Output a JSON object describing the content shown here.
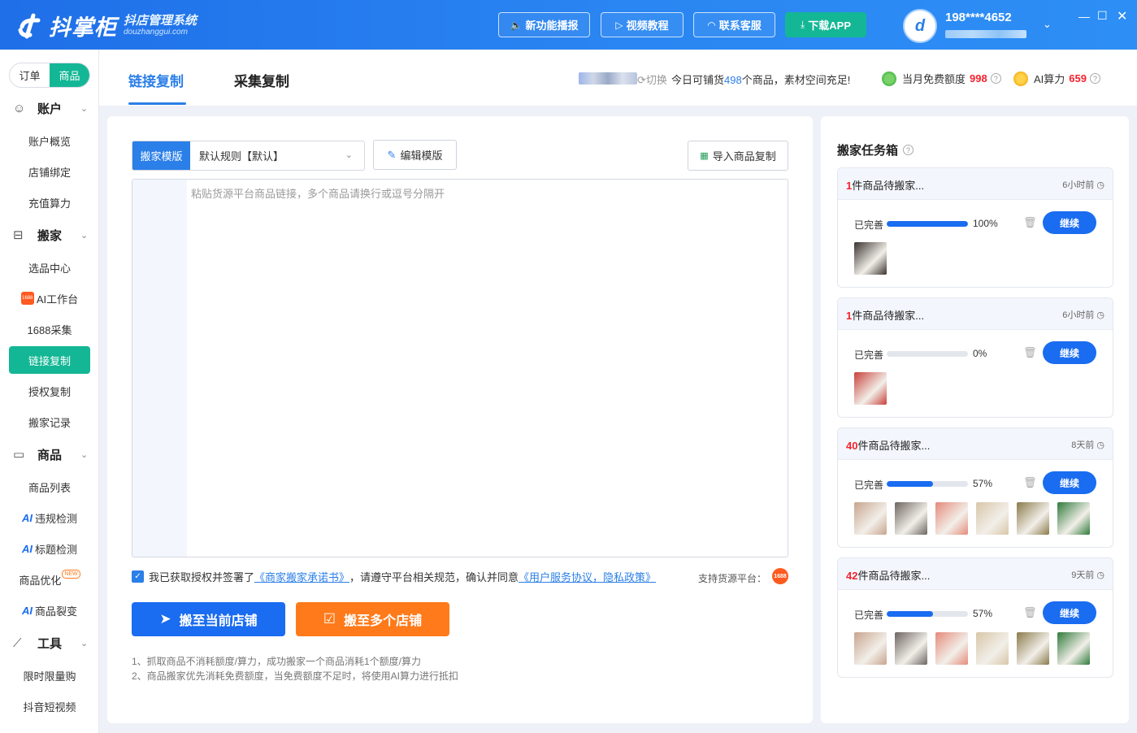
{
  "app": {
    "logo_text": "抖掌柜",
    "logo_sub": "抖店管理系统",
    "logo_domain": "douzhanggui.com"
  },
  "titlebar": {
    "buttons": [
      {
        "label": "新功能播报",
        "icon": "speaker-icon"
      },
      {
        "label": "视频教程",
        "icon": "video-icon"
      },
      {
        "label": "联系客服",
        "icon": "headset-icon"
      },
      {
        "label": "下载APP",
        "icon": "download-icon"
      }
    ],
    "user_phone": "198****4652",
    "window_controls": [
      "minimize",
      "maximize",
      "close"
    ]
  },
  "sidebar": {
    "segment": {
      "orders": "订单",
      "products": "商品",
      "selected": "商品"
    },
    "sections": [
      {
        "label": "账户",
        "icon": "account-icon",
        "items": [
          "账户概览",
          "店铺绑定",
          "充值算力"
        ]
      },
      {
        "label": "搬家",
        "icon": "move-icon",
        "items": [
          "选品中心",
          "AI工作台",
          "1688采集",
          "链接复制",
          "授权复制",
          "搬家记录"
        ]
      },
      {
        "label": "商品",
        "icon": "product-icon",
        "items": [
          "商品列表",
          "违规检测",
          "标题检测",
          "商品优化",
          "商品裂变"
        ]
      },
      {
        "label": "工具",
        "icon": "chart-icon",
        "items": [
          "限时限量购",
          "抖音短视频"
        ]
      }
    ],
    "active_item": "链接复制",
    "ai_prefix": "AI",
    "new_badge": "NEW",
    "badge_1688": "1688"
  },
  "tabs": [
    {
      "label": "链接复制",
      "active": true
    },
    {
      "label": "采集复制",
      "active": false
    }
  ],
  "topinfo": {
    "switch": "切换",
    "msg_pre": "今日可铺货",
    "msg_num": "498",
    "msg_post": "个商品，素材空间充足!",
    "free_quota_label": "当月免费额度",
    "free_quota_value": "998",
    "ai_power_label": "AI算力",
    "ai_power_value": "659"
  },
  "form": {
    "template_label": "搬家模版",
    "template_value": "默认规则【默认】",
    "edit_template": "编辑模版",
    "import_copy": "导入商品复制",
    "placeholder": "粘贴货源平台商品链接，多个商品请换行或逗号分隔开",
    "agree_pre": "我已获取授权并签署了",
    "agree_link1": "《商家搬家承诺书》",
    "agree_mid": "，请遵守平台相关规范，确认并同意",
    "agree_link2": "《用户服务协议，隐私政策》",
    "support_label": "支持货源平台：",
    "btn_current": "搬至当前店铺",
    "btn_multi": "搬至多个店铺",
    "notes": [
      "1、抓取商品不消耗额度/算力，成功搬家一个商品消耗1个额度/算力",
      "2、商品搬家优先消耗免费额度，当免费额度不足时，将使用AI算力进行抵扣"
    ]
  },
  "taskbox": {
    "title": "搬家任务箱",
    "done_label": "已完善",
    "continue_label": "继续",
    "tasks": [
      {
        "count": "1",
        "suffix": "件商品待搬家...",
        "time": "6小时前",
        "progress_text": "100%",
        "progress": 1.0,
        "thumbs": [
          "#3a3230"
        ]
      },
      {
        "count": "1",
        "suffix": "件商品待搬家...",
        "time": "6小时前",
        "progress_text": "0%",
        "progress": 0.0,
        "thumbs": [
          "#c9403a"
        ]
      },
      {
        "count": "40",
        "suffix": "件商品待搬家...",
        "time": "8天前",
        "progress_text": "57%",
        "progress": 0.57,
        "thumbs": [
          "#c8a48e",
          "#6c6460",
          "#e58a7a",
          "#d8c6a8",
          "#8a7a4a",
          "#2f7a3a"
        ]
      },
      {
        "count": "42",
        "suffix": "件商品待搬家...",
        "time": "9天前",
        "progress_text": "57%",
        "progress": 0.57,
        "thumbs": [
          "#c8a48e",
          "#6c6460",
          "#e58a7a",
          "#d8c6a8",
          "#8a7a4a",
          "#2f7a3a"
        ]
      }
    ]
  },
  "colors": {
    "brand_blue": "#2b7fe8",
    "teal": "#14b795",
    "orange": "#ff7a1a",
    "red": "#f5222d"
  }
}
